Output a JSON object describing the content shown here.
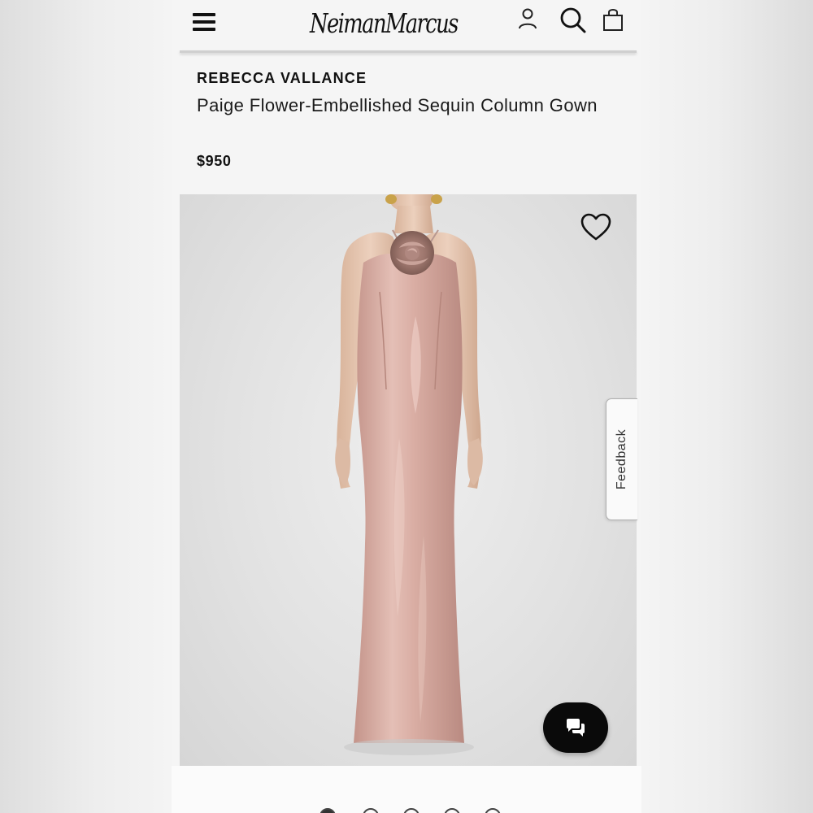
{
  "header": {
    "logo_text": "NeimanMarcus",
    "icons": [
      "menu-icon",
      "account-icon",
      "search-icon",
      "shopping-bag-icon"
    ]
  },
  "product": {
    "brand": "REBECCA VALLANCE",
    "name": "Paige Flower-Embellished Sequin Column Gown",
    "price": "$950"
  },
  "gallery": {
    "image_count": 5,
    "active_index": 0
  },
  "feedback": {
    "label": "Feedback"
  },
  "colors": {
    "accent": "#111111",
    "background": "#f5f5f5",
    "gown": "#d9ada3",
    "image_backdrop": "#e2e2e2"
  }
}
